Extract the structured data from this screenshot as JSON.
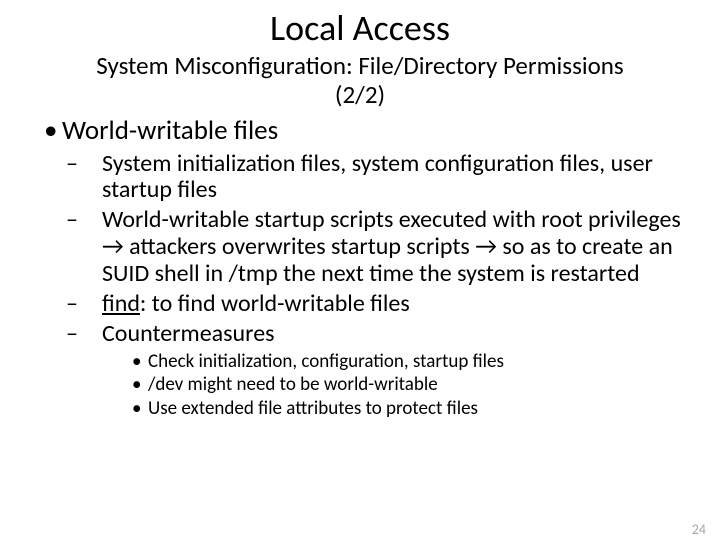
{
  "title": "Local Access",
  "subtitle_line1": "System Misconfiguration: File/Directory Permissions",
  "subtitle_line2": "(2/2)",
  "lvl1_bullet": "•",
  "lvl1_text": "World-writable files",
  "arrow": "→",
  "sub": [
    {
      "dash": "–",
      "text": "System initialization files, system configuration files, user startup files"
    },
    {
      "dash": "–",
      "parts": {
        "p1": "World-writable startup scripts executed with root privileges ",
        "p2": " attackers overwrites startup scripts ",
        "p3": " so as to create an SUID shell in /tmp the next time the system is restarted"
      }
    },
    {
      "dash": "–",
      "underlined": "find",
      "rest": ": to find world-writable files"
    },
    {
      "dash": "–",
      "text": "Countermeasures"
    }
  ],
  "cm_bullet": "•",
  "counter": [
    "Check initialization, configuration, startup files",
    "/dev might need to be world-writable",
    "Use extended file attributes to protect files"
  ],
  "page_number": "24"
}
